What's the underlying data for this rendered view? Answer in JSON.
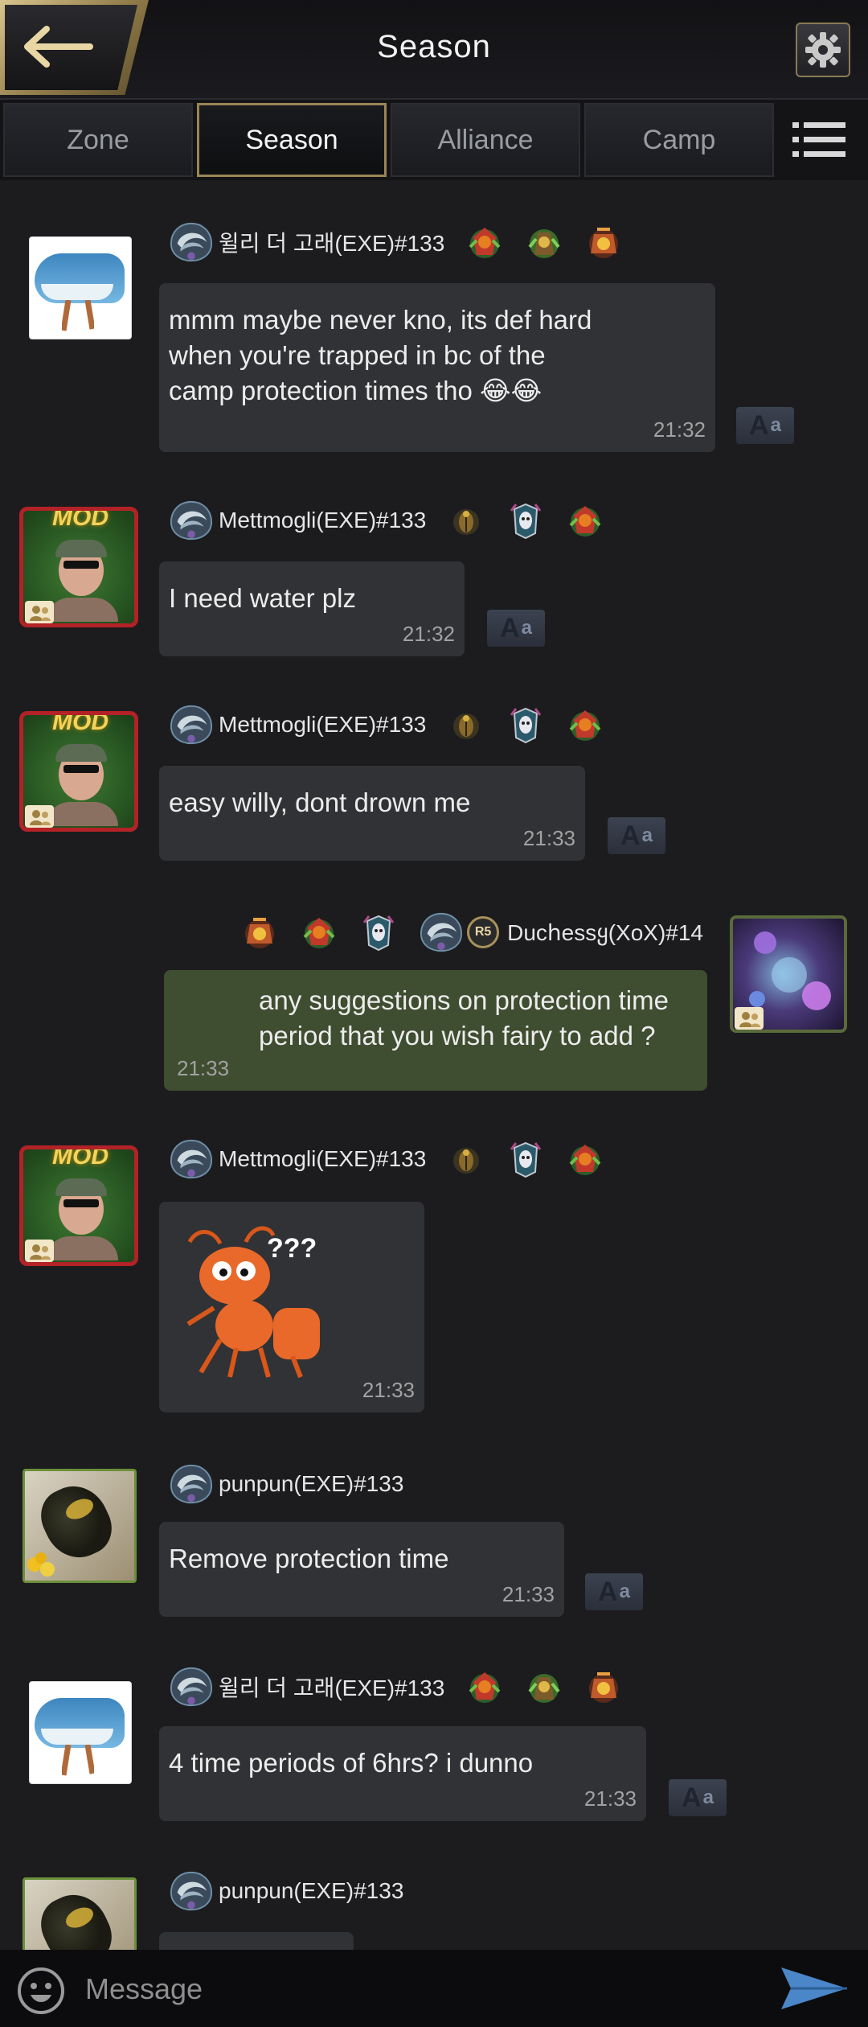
{
  "header": {
    "title": "Season"
  },
  "tabs": [
    {
      "label": "Zone",
      "active": false
    },
    {
      "label": "Season",
      "active": true
    },
    {
      "label": "Alliance",
      "active": false
    },
    {
      "label": "Camp",
      "active": false
    }
  ],
  "icons": {
    "back": "back-arrow-icon",
    "settings": "gear-icon",
    "menu": "menu-icon",
    "translate": "translate-icon",
    "emoji": "emoji-icon",
    "send": "send-arrow-icon"
  },
  "translate_label": {
    "big": "A",
    "small": "a"
  },
  "messages": [
    {
      "author": "윌리 더 고래(EXE)#133",
      "text": "mmm maybe never kno, its def hard\nwhen you're trapped in bc of the\ncamp protection times tho 😂😂",
      "time": "21:32"
    },
    {
      "author": "Mettmogli(EXE)#133",
      "mod_tag": "MOD",
      "text": "I need water plz",
      "time": "21:32"
    },
    {
      "author": "Mettmogli(EXE)#133",
      "mod_tag": "MOD",
      "text": "easy willy, dont drown me",
      "time": "21:33"
    },
    {
      "author": "Ducհessყ(XoX)#14",
      "rank": "R5",
      "text": "any suggestions on protection time\nperiod that you wish fairy to add ?",
      "time": "21:33",
      "mine": true
    },
    {
      "author": "Mettmogli(EXE)#133",
      "mod_tag": "MOD",
      "sticker_text": "???",
      "time": "21:33"
    },
    {
      "author": "punpun(EXE)#133",
      "text": "Remove protection time",
      "time": "21:33"
    },
    {
      "author": "윌리 더 고래(EXE)#133",
      "text": "4 time periods of 6hrs? i dunno",
      "time": "21:33"
    },
    {
      "author": "punpun(EXE)#133"
    }
  ],
  "composer": {
    "placeholder": "Message"
  },
  "colors": {
    "accent_gold": "#9a8556",
    "my_bubble": "#3f4d30",
    "other_bubble": "#313235",
    "background": "#1c1c1f"
  }
}
